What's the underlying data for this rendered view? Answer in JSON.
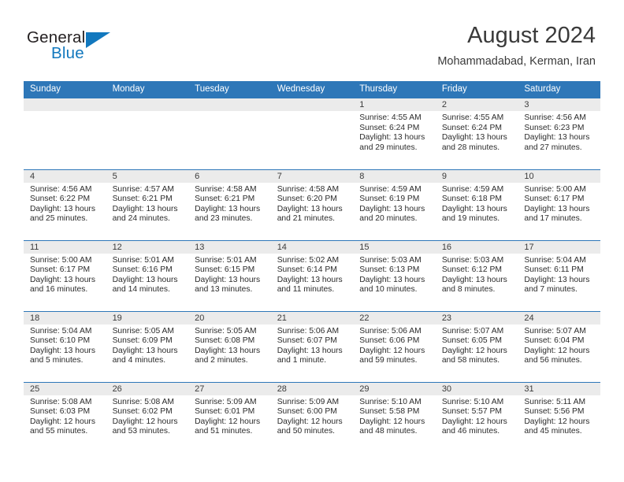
{
  "brand": {
    "name_part1": "General",
    "name_part2": "Blue",
    "triangle_icon": "triangle-icon",
    "accent_color": "#1278be"
  },
  "header": {
    "month_title": "August 2024",
    "location": "Mohammadabad, Kerman, Iran"
  },
  "calendar": {
    "header_bg": "#2e77b8",
    "daystrip_bg": "#ebebeb",
    "weekday_names": [
      "Sunday",
      "Monday",
      "Tuesday",
      "Wednesday",
      "Thursday",
      "Friday",
      "Saturday"
    ],
    "weeks": [
      [
        {
          "day": "",
          "blank": true,
          "sunrise": "",
          "sunset": "",
          "daylight1": "",
          "daylight2": ""
        },
        {
          "day": "",
          "blank": true,
          "sunrise": "",
          "sunset": "",
          "daylight1": "",
          "daylight2": ""
        },
        {
          "day": "",
          "blank": true,
          "sunrise": "",
          "sunset": "",
          "daylight1": "",
          "daylight2": ""
        },
        {
          "day": "",
          "blank": true,
          "sunrise": "",
          "sunset": "",
          "daylight1": "",
          "daylight2": ""
        },
        {
          "day": "1",
          "blank": false,
          "sunrise": "Sunrise: 4:55 AM",
          "sunset": "Sunset: 6:24 PM",
          "daylight1": "Daylight: 13 hours",
          "daylight2": "and 29 minutes."
        },
        {
          "day": "2",
          "blank": false,
          "sunrise": "Sunrise: 4:55 AM",
          "sunset": "Sunset: 6:24 PM",
          "daylight1": "Daylight: 13 hours",
          "daylight2": "and 28 minutes."
        },
        {
          "day": "3",
          "blank": false,
          "sunrise": "Sunrise: 4:56 AM",
          "sunset": "Sunset: 6:23 PM",
          "daylight1": "Daylight: 13 hours",
          "daylight2": "and 27 minutes."
        }
      ],
      [
        {
          "day": "4",
          "blank": false,
          "sunrise": "Sunrise: 4:56 AM",
          "sunset": "Sunset: 6:22 PM",
          "daylight1": "Daylight: 13 hours",
          "daylight2": "and 25 minutes."
        },
        {
          "day": "5",
          "blank": false,
          "sunrise": "Sunrise: 4:57 AM",
          "sunset": "Sunset: 6:21 PM",
          "daylight1": "Daylight: 13 hours",
          "daylight2": "and 24 minutes."
        },
        {
          "day": "6",
          "blank": false,
          "sunrise": "Sunrise: 4:58 AM",
          "sunset": "Sunset: 6:21 PM",
          "daylight1": "Daylight: 13 hours",
          "daylight2": "and 23 minutes."
        },
        {
          "day": "7",
          "blank": false,
          "sunrise": "Sunrise: 4:58 AM",
          "sunset": "Sunset: 6:20 PM",
          "daylight1": "Daylight: 13 hours",
          "daylight2": "and 21 minutes."
        },
        {
          "day": "8",
          "blank": false,
          "sunrise": "Sunrise: 4:59 AM",
          "sunset": "Sunset: 6:19 PM",
          "daylight1": "Daylight: 13 hours",
          "daylight2": "and 20 minutes."
        },
        {
          "day": "9",
          "blank": false,
          "sunrise": "Sunrise: 4:59 AM",
          "sunset": "Sunset: 6:18 PM",
          "daylight1": "Daylight: 13 hours",
          "daylight2": "and 19 minutes."
        },
        {
          "day": "10",
          "blank": false,
          "sunrise": "Sunrise: 5:00 AM",
          "sunset": "Sunset: 6:17 PM",
          "daylight1": "Daylight: 13 hours",
          "daylight2": "and 17 minutes."
        }
      ],
      [
        {
          "day": "11",
          "blank": false,
          "sunrise": "Sunrise: 5:00 AM",
          "sunset": "Sunset: 6:17 PM",
          "daylight1": "Daylight: 13 hours",
          "daylight2": "and 16 minutes."
        },
        {
          "day": "12",
          "blank": false,
          "sunrise": "Sunrise: 5:01 AM",
          "sunset": "Sunset: 6:16 PM",
          "daylight1": "Daylight: 13 hours",
          "daylight2": "and 14 minutes."
        },
        {
          "day": "13",
          "blank": false,
          "sunrise": "Sunrise: 5:01 AM",
          "sunset": "Sunset: 6:15 PM",
          "daylight1": "Daylight: 13 hours",
          "daylight2": "and 13 minutes."
        },
        {
          "day": "14",
          "blank": false,
          "sunrise": "Sunrise: 5:02 AM",
          "sunset": "Sunset: 6:14 PM",
          "daylight1": "Daylight: 13 hours",
          "daylight2": "and 11 minutes."
        },
        {
          "day": "15",
          "blank": false,
          "sunrise": "Sunrise: 5:03 AM",
          "sunset": "Sunset: 6:13 PM",
          "daylight1": "Daylight: 13 hours",
          "daylight2": "and 10 minutes."
        },
        {
          "day": "16",
          "blank": false,
          "sunrise": "Sunrise: 5:03 AM",
          "sunset": "Sunset: 6:12 PM",
          "daylight1": "Daylight: 13 hours",
          "daylight2": "and 8 minutes."
        },
        {
          "day": "17",
          "blank": false,
          "sunrise": "Sunrise: 5:04 AM",
          "sunset": "Sunset: 6:11 PM",
          "daylight1": "Daylight: 13 hours",
          "daylight2": "and 7 minutes."
        }
      ],
      [
        {
          "day": "18",
          "blank": false,
          "sunrise": "Sunrise: 5:04 AM",
          "sunset": "Sunset: 6:10 PM",
          "daylight1": "Daylight: 13 hours",
          "daylight2": "and 5 minutes."
        },
        {
          "day": "19",
          "blank": false,
          "sunrise": "Sunrise: 5:05 AM",
          "sunset": "Sunset: 6:09 PM",
          "daylight1": "Daylight: 13 hours",
          "daylight2": "and 4 minutes."
        },
        {
          "day": "20",
          "blank": false,
          "sunrise": "Sunrise: 5:05 AM",
          "sunset": "Sunset: 6:08 PM",
          "daylight1": "Daylight: 13 hours",
          "daylight2": "and 2 minutes."
        },
        {
          "day": "21",
          "blank": false,
          "sunrise": "Sunrise: 5:06 AM",
          "sunset": "Sunset: 6:07 PM",
          "daylight1": "Daylight: 13 hours",
          "daylight2": "and 1 minute."
        },
        {
          "day": "22",
          "blank": false,
          "sunrise": "Sunrise: 5:06 AM",
          "sunset": "Sunset: 6:06 PM",
          "daylight1": "Daylight: 12 hours",
          "daylight2": "and 59 minutes."
        },
        {
          "day": "23",
          "blank": false,
          "sunrise": "Sunrise: 5:07 AM",
          "sunset": "Sunset: 6:05 PM",
          "daylight1": "Daylight: 12 hours",
          "daylight2": "and 58 minutes."
        },
        {
          "day": "24",
          "blank": false,
          "sunrise": "Sunrise: 5:07 AM",
          "sunset": "Sunset: 6:04 PM",
          "daylight1": "Daylight: 12 hours",
          "daylight2": "and 56 minutes."
        }
      ],
      [
        {
          "day": "25",
          "blank": false,
          "sunrise": "Sunrise: 5:08 AM",
          "sunset": "Sunset: 6:03 PM",
          "daylight1": "Daylight: 12 hours",
          "daylight2": "and 55 minutes."
        },
        {
          "day": "26",
          "blank": false,
          "sunrise": "Sunrise: 5:08 AM",
          "sunset": "Sunset: 6:02 PM",
          "daylight1": "Daylight: 12 hours",
          "daylight2": "and 53 minutes."
        },
        {
          "day": "27",
          "blank": false,
          "sunrise": "Sunrise: 5:09 AM",
          "sunset": "Sunset: 6:01 PM",
          "daylight1": "Daylight: 12 hours",
          "daylight2": "and 51 minutes."
        },
        {
          "day": "28",
          "blank": false,
          "sunrise": "Sunrise: 5:09 AM",
          "sunset": "Sunset: 6:00 PM",
          "daylight1": "Daylight: 12 hours",
          "daylight2": "and 50 minutes."
        },
        {
          "day": "29",
          "blank": false,
          "sunrise": "Sunrise: 5:10 AM",
          "sunset": "Sunset: 5:58 PM",
          "daylight1": "Daylight: 12 hours",
          "daylight2": "and 48 minutes."
        },
        {
          "day": "30",
          "blank": false,
          "sunrise": "Sunrise: 5:10 AM",
          "sunset": "Sunset: 5:57 PM",
          "daylight1": "Daylight: 12 hours",
          "daylight2": "and 46 minutes."
        },
        {
          "day": "31",
          "blank": false,
          "sunrise": "Sunrise: 5:11 AM",
          "sunset": "Sunset: 5:56 PM",
          "daylight1": "Daylight: 12 hours",
          "daylight2": "and 45 minutes."
        }
      ]
    ]
  }
}
